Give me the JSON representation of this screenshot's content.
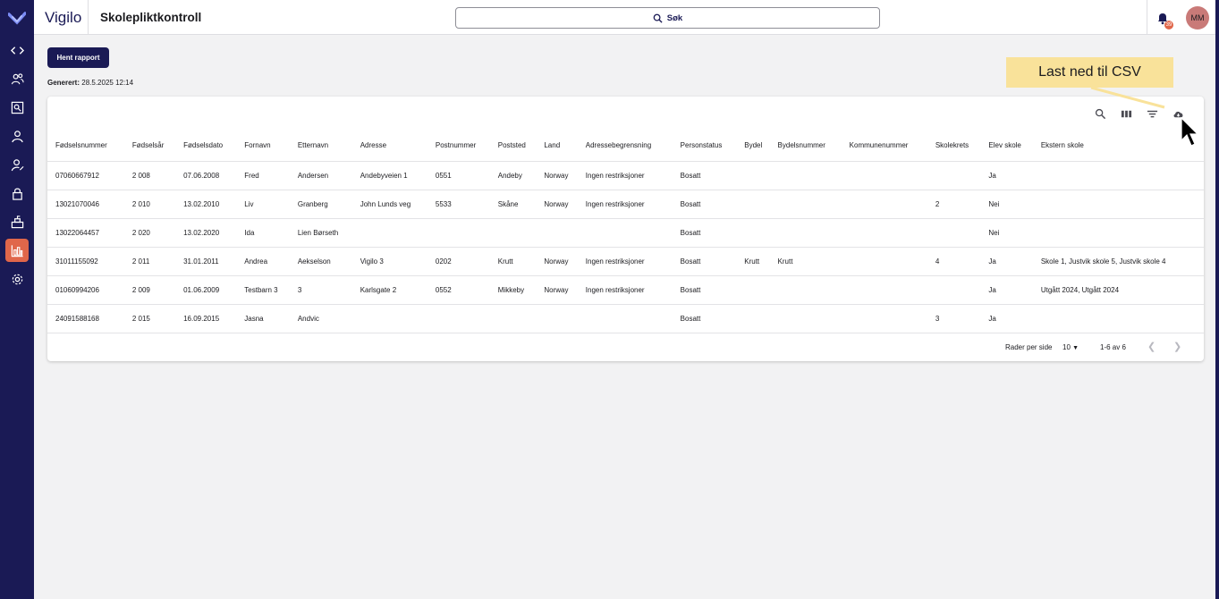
{
  "app": {
    "brand": "Vigilo",
    "page_title": "Skolepliktkontroll"
  },
  "search": {
    "label": "Søk"
  },
  "notifications": {
    "badge": "39"
  },
  "user": {
    "initials": "MM"
  },
  "sidebar": {
    "items": [
      {
        "icon": "code-icon"
      },
      {
        "icon": "users-icon"
      },
      {
        "icon": "search-person-icon"
      },
      {
        "icon": "person-icon"
      },
      {
        "icon": "person-edit-icon"
      },
      {
        "icon": "lock-icon"
      },
      {
        "icon": "school-icon"
      },
      {
        "icon": "chart-icon",
        "active": true
      },
      {
        "icon": "gear-icon"
      }
    ]
  },
  "report": {
    "button_label": "Hent rapport",
    "generated_label": "Generert:",
    "generated_value": "28.5.2025 12:14"
  },
  "table": {
    "columns": [
      "Fødselsnummer",
      "Fødselsår",
      "Fødselsdato",
      "Fornavn",
      "Etternavn",
      "Adresse",
      "Postnummer",
      "Poststed",
      "Land",
      "Adressebegrensning",
      "Personstatus",
      "Bydel",
      "Bydelsnummer",
      "Kommunenummer",
      "Skolekrets",
      "Elev skole",
      "Ekstern skole"
    ],
    "rows": [
      [
        "07060667912",
        "2 008",
        "07.06.2008",
        "Fred",
        "Andersen",
        "Andebyveien 1",
        "0551",
        "Andeby",
        "Norway",
        "Ingen restriksjoner",
        "Bosatt",
        "",
        "",
        "",
        "",
        "Ja",
        ""
      ],
      [
        "13021070046",
        "2 010",
        "13.02.2010",
        "Liv",
        "Granberg",
        "John Lunds veg",
        "5533",
        "Skåne",
        "Norway",
        "Ingen restriksjoner",
        "Bosatt",
        "",
        "",
        "",
        "2",
        "Nei",
        ""
      ],
      [
        "13022064457",
        "2 020",
        "13.02.2020",
        "Ida",
        "Lien Børseth",
        "",
        "",
        "",
        "",
        "",
        "Bosatt",
        "",
        "",
        "",
        "",
        "Nei",
        ""
      ],
      [
        "31011155092",
        "2 011",
        "31.01.2011",
        "Andrea",
        "Aekselson",
        "Vigilo 3",
        "0202",
        "Krutt",
        "Norway",
        "Ingen restriksjoner",
        "Bosatt",
        "Krutt",
        "Krutt",
        "",
        "4",
        "Ja",
        "Skole 1, Justvik skole 5, Justvik skole 4"
      ],
      [
        "01060994206",
        "2 009",
        "01.06.2009",
        "Testbarn 3",
        "3",
        "Karlsgate 2",
        "0552",
        "Mikkeby",
        "Norway",
        "Ingen restriksjoner",
        "Bosatt",
        "",
        "",
        "",
        "",
        "Ja",
        "Utgått 2024, Utgått 2024"
      ],
      [
        "24091588168",
        "2 015",
        "16.09.2015",
        "Jasna",
        "Andvic",
        "",
        "",
        "",
        "",
        "",
        "Bosatt",
        "",
        "",
        "",
        "3",
        "Ja",
        ""
      ]
    ]
  },
  "pagination": {
    "rows_per_page_label": "Rader per side",
    "rows_per_page": "10",
    "range": "1-6 av 6"
  },
  "tooltip": {
    "text": "Last ned til CSV"
  }
}
